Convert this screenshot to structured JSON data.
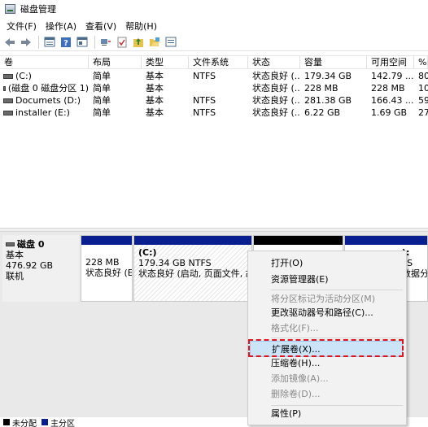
{
  "window": {
    "title": "磁盘管理"
  },
  "menu": [
    "文件(F)",
    "操作(A)",
    "查看(V)",
    "帮助(H)"
  ],
  "toolbar": {
    "icons": [
      "back-arrow-icon",
      "forward-arrow-icon",
      "disk-list-icon",
      "help-icon",
      "properties-icon",
      "connect-icon",
      "check-icon",
      "folder-up-icon",
      "open-folder-icon",
      "console-icon"
    ]
  },
  "volumes": {
    "headers": [
      "卷",
      "布局",
      "类型",
      "文件系统",
      "状态",
      "容量",
      "可用空间",
      "%"
    ],
    "rows": [
      {
        "name": "(C:)",
        "layout": "简单",
        "type": "基本",
        "fs": "NTFS",
        "status": "状态良好 (...",
        "capacity": "179.34 GB",
        "free": "142.79 ...",
        "pct": "80"
      },
      {
        "name": "(磁盘 0 磁盘分区 1)",
        "layout": "简单",
        "type": "基本",
        "fs": "",
        "status": "状态良好 (...",
        "capacity": "228 MB",
        "free": "228 MB",
        "pct": "10"
      },
      {
        "name": "Documets (D:)",
        "layout": "简单",
        "type": "基本",
        "fs": "NTFS",
        "status": "状态良好 (...",
        "capacity": "281.38 GB",
        "free": "166.43 ...",
        "pct": "59"
      },
      {
        "name": "installer (E:)",
        "layout": "简单",
        "type": "基本",
        "fs": "NTFS",
        "status": "状态良好 (...",
        "capacity": "6.22 GB",
        "free": "1.69 GB",
        "pct": "27"
      }
    ]
  },
  "disk": {
    "name": "磁盘 0",
    "type": "基本",
    "size": "476.92 GB",
    "state": "联机",
    "partitions": [
      {
        "line1": "228 MB",
        "line2": "状态良好 (E"
      },
      {
        "title": "(C:)",
        "line1": "179.34 GB NTFS",
        "line2": "状态良好 (启动, 页面文件, 故障"
      },
      {
        "title": "",
        "line1": "",
        "line2": ""
      },
      {
        "title": "):",
        "line1": "FS",
        "line2": "数据分"
      }
    ]
  },
  "legend": [
    "未分配",
    "主分区"
  ],
  "colors": {
    "unallocated": "#000000",
    "primary": "#0a1f8f",
    "highlight_outline": "#e0141c"
  },
  "context_menu": {
    "items": [
      {
        "label": "打开(O)",
        "enabled": true
      },
      {
        "label": "资源管理器(E)",
        "enabled": true
      },
      {
        "label": "将分区标记为活动分区(M)",
        "enabled": false
      },
      {
        "label": "更改驱动器号和路径(C)...",
        "enabled": true
      },
      {
        "label": "格式化(F)...",
        "enabled": false
      },
      {
        "label": "扩展卷(X)...",
        "enabled": true,
        "highlighted": true
      },
      {
        "label": "压缩卷(H)...",
        "enabled": true
      },
      {
        "label": "添加镜像(A)...",
        "enabled": false
      },
      {
        "label": "删除卷(D)...",
        "enabled": false
      },
      {
        "label": "属性(P)",
        "enabled": true
      }
    ]
  }
}
